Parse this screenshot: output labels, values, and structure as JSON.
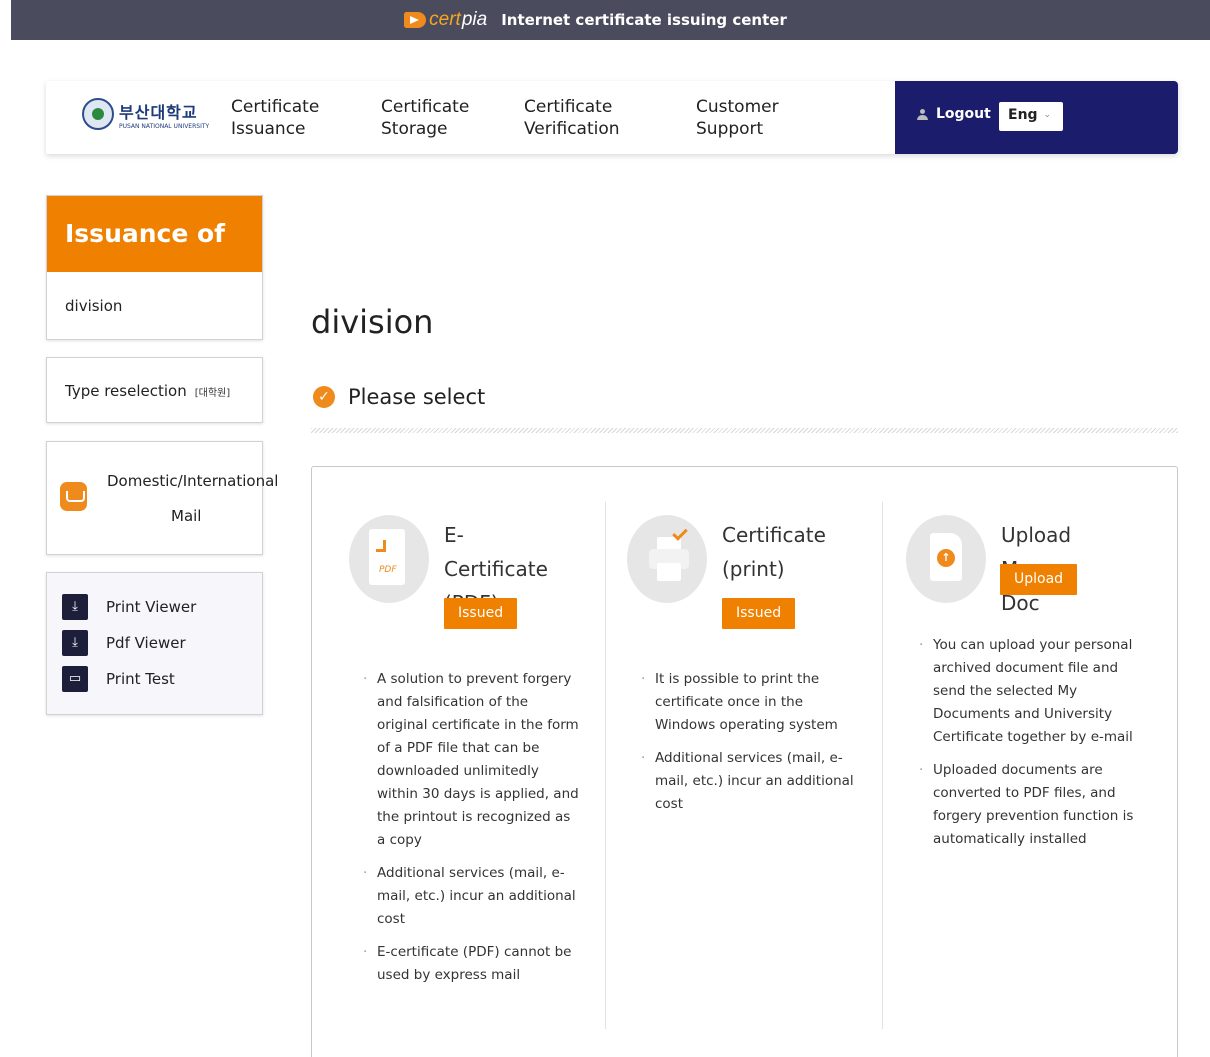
{
  "topbar": {
    "logo_main": "cert",
    "logo_sub": "pia",
    "title": "Internet certificate issuing center"
  },
  "header": {
    "university_kr": "부산대학교",
    "university_en": "PUSAN NATIONAL UNIVERSITY",
    "nav": [
      {
        "line1": "Certificate",
        "line2": "Issuance"
      },
      {
        "line1": "Certificate",
        "line2": "Storage"
      },
      {
        "line1": "Certificate",
        "line2": "Verification"
      },
      {
        "line1": "Customer",
        "line2": "Support"
      }
    ],
    "logout": "Logout",
    "lang": "Eng"
  },
  "sidebar": {
    "issuance_title": "Issuance of",
    "division": "division",
    "type_reselection": "Type reselection",
    "type_tag": "[대학원]",
    "mail_line1": "Domestic/International",
    "mail_line2": "Mail",
    "tools": [
      "Print Viewer",
      "Pdf Viewer",
      "Print Test"
    ]
  },
  "main": {
    "title": "division",
    "select_label": "Please select",
    "options": [
      {
        "title1": "E-Certificate",
        "title2": "(PDF)",
        "button": "Issued",
        "bullets": [
          "A solution to prevent forgery and falsification of the original certificate in the form of a PDF file that can be downloaded unlimitedly within 30 days is applied, and the printout is recognized as a copy",
          "Additional services (mail, e-mail, etc.) incur an additional cost",
          "E-certificate (PDF) cannot be used by express mail"
        ]
      },
      {
        "title1": "Certificate",
        "title2": "(print)",
        "button": "Issued",
        "bullets": [
          "It is possible to print the certificate once in the Windows operating system",
          "Additional services (mail, e-mail, etc.) incur an additional cost"
        ]
      },
      {
        "title1": "Upload My Doc",
        "button": "Upload",
        "bullets": [
          "You can upload your personal archived document file and send the selected My Documents and University Certificate together by e-mail",
          "Uploaded documents are converted to PDF files, and forgery prevention function is automatically installed"
        ]
      }
    ]
  },
  "icons": {
    "pdf_label": "PDF"
  },
  "colors": {
    "accent": "#ef8000",
    "nav_panel": "#1b1c6b",
    "topbar": "#4a4b5c"
  }
}
